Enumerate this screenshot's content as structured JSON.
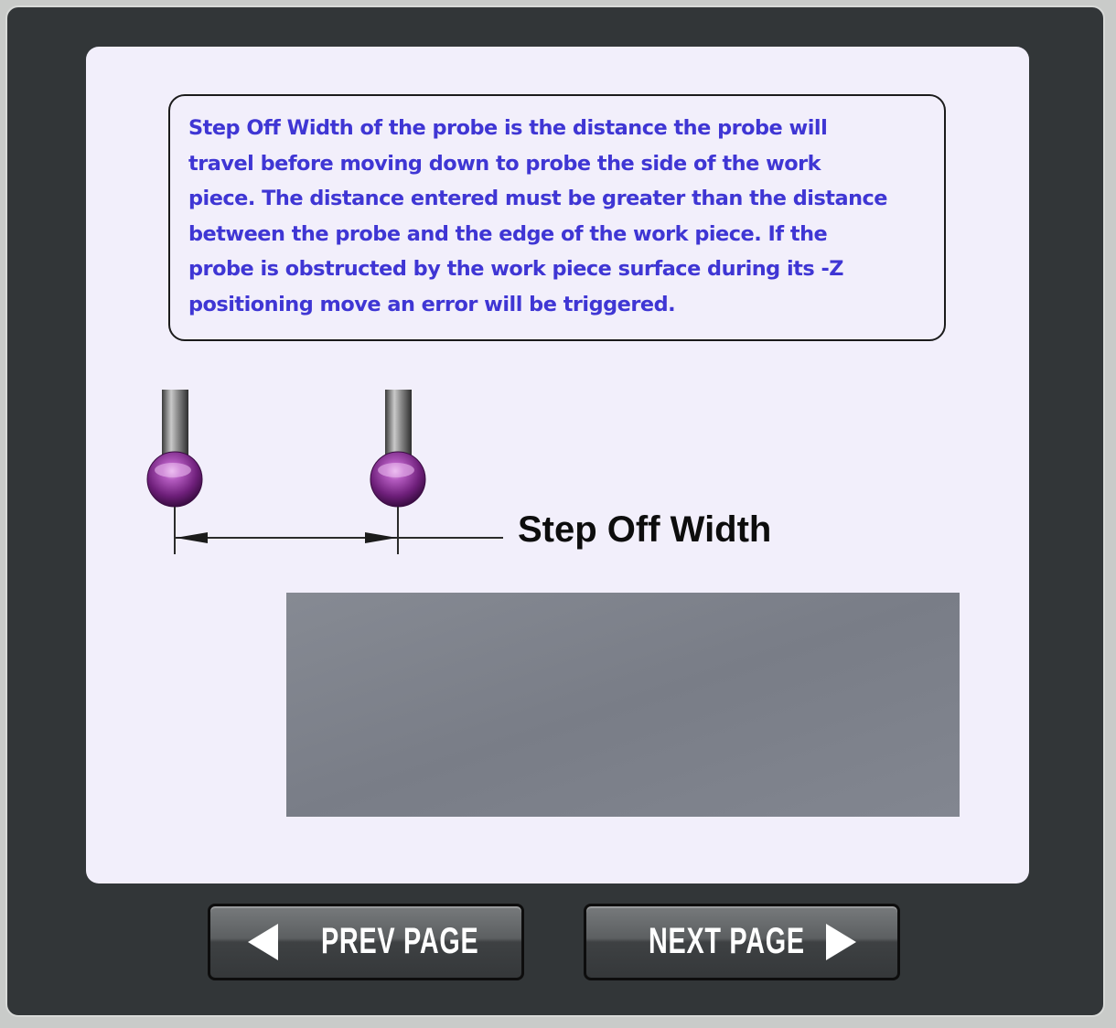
{
  "description": {
    "lines": [
      "Step Off Width of the probe is the distance the probe will",
      "travel before moving down to probe the side of the work",
      "piece. The distance entered must be greater than the distance",
      "between the probe and the edge of the work piece.  If the",
      "probe is obstructed by the work piece surface during its -Z",
      "positioning move an error will be triggered."
    ],
    "color": "#3f36d4"
  },
  "diagram": {
    "dimension_label": "Step Off Width",
    "probe_ball_color": "#8a2a95",
    "workpiece_color": "#7b7f89"
  },
  "navigation": {
    "prev_label": "PREV PAGE",
    "next_label": "NEXT PAGE",
    "prev_icon": "left-triangle-icon",
    "next_icon": "right-triangle-icon"
  }
}
